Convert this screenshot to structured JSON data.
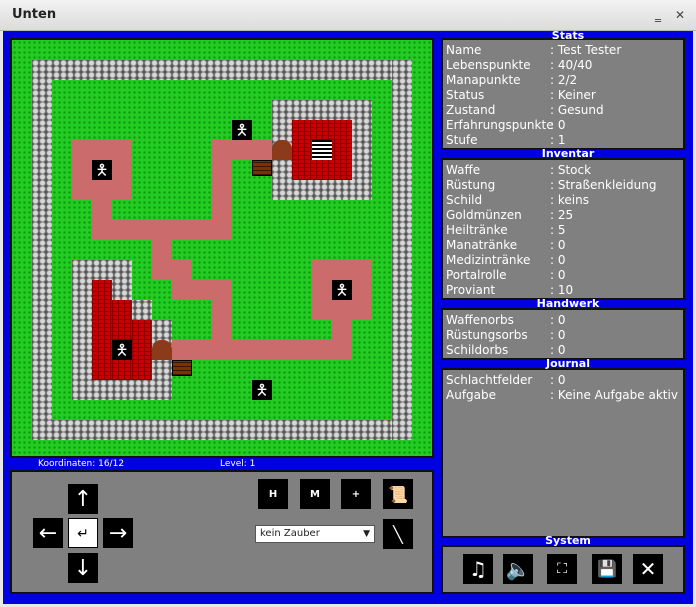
{
  "window": {
    "title": "Unten"
  },
  "sections": {
    "stats": "Stats",
    "inventar": "Inventar",
    "handwerk": "Handwerk",
    "journal": "Journal",
    "system": "System"
  },
  "status": {
    "koordinaten": "Koordinaten: 16/12",
    "level": "Level: 1"
  },
  "stats": [
    {
      "label": "Name",
      "value": ": Test Tester"
    },
    {
      "label": "Lebenspunkte",
      "value": ": 40/40"
    },
    {
      "label": "Manapunkte",
      "value": ": 2/2"
    },
    {
      "label": "Status",
      "value": ": Keiner"
    },
    {
      "label": "Zustand",
      "value": ": Gesund"
    },
    {
      "label": "Erfahrungspunkte",
      "value": ": 0"
    },
    {
      "label": "Stufe",
      "value": ": 1"
    }
  ],
  "inventar": [
    {
      "label": "Waffe",
      "value": ": Stock"
    },
    {
      "label": "Rüstung",
      "value": ": Straßenkleidung"
    },
    {
      "label": "Schild",
      "value": ": keins"
    },
    {
      "label": "Goldmünzen",
      "value": ": 25"
    },
    {
      "label": "Heiltränke",
      "value": ": 5"
    },
    {
      "label": "Manatränke",
      "value": ": 0"
    },
    {
      "label": "Medizintränke",
      "value": ": 0"
    },
    {
      "label": "Portalrolle",
      "value": ": 0"
    },
    {
      "label": "Proviant",
      "value": ": 10"
    }
  ],
  "handwerk": [
    {
      "label": "Waffenorbs",
      "value": ": 0"
    },
    {
      "label": "Rüstungsorbs",
      "value": ": 0"
    },
    {
      "label": "Schildorbs",
      "value": ": 0"
    }
  ],
  "journal": [
    {
      "label": "Schlachtfelder",
      "value": ": 0"
    },
    {
      "label": "Aufgabe",
      "value": ": Keine Aufgabe aktiv"
    }
  ],
  "controls": {
    "flask_h": "H",
    "flask_m": "M",
    "flask_plus": "+",
    "spell_select": "kein Zauber"
  },
  "icons": {
    "arrow_up": "arrow-up-icon",
    "arrow_down": "arrow-down-icon",
    "arrow_left": "arrow-left-icon",
    "arrow_right": "arrow-right-icon",
    "music": "music-note-icon",
    "sfx": "speaker-icon",
    "fullscreen": "fullscreen-icon",
    "save": "floppy-disk-icon",
    "quit": "close-icon"
  },
  "colors": {
    "frame": "#0000e0",
    "panel": "#808080",
    "grass": "#22cc22",
    "path": "#cc6b6b",
    "floor": "#c80000"
  }
}
